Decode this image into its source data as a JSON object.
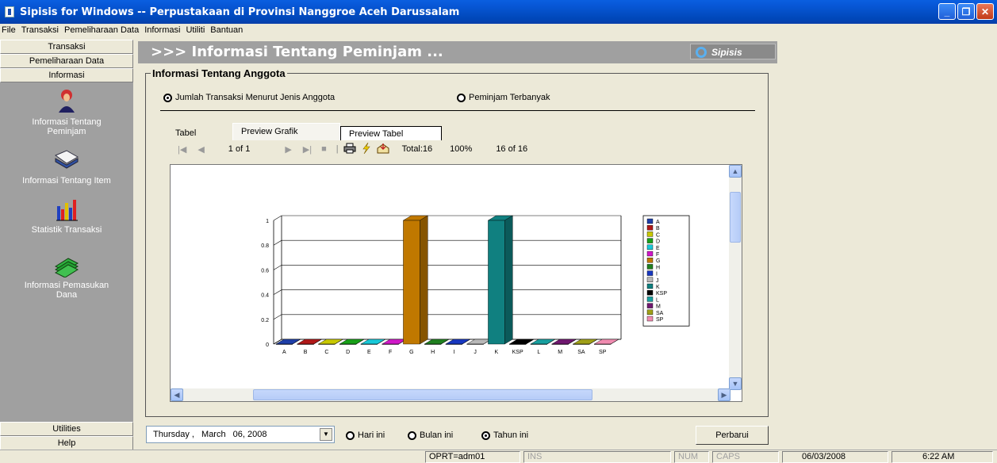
{
  "window": {
    "title": "Sipisis for Windows -- Perpustakaan di Provinsi Nanggroe Aceh Darussalam"
  },
  "menu": [
    "File",
    "Transaksi",
    "Pemeliharaan Data",
    "Informasi",
    "Utiliti",
    "Bantuan"
  ],
  "sidebar": {
    "headers": [
      "Transaksi",
      "Pemeliharaan Data",
      "Informasi"
    ],
    "items": [
      {
        "label": "Informasi Tentang Peminjam",
        "icon": "person-icon"
      },
      {
        "label": "Informasi Tentang Item",
        "icon": "book-icon"
      },
      {
        "label": "Statistik Transaksi",
        "icon": "bar-chart-icon"
      },
      {
        "label": "Informasi Pemasukan Dana",
        "icon": "money-icon"
      }
    ],
    "footer": [
      "Utilities",
      "Help"
    ]
  },
  "main": {
    "heading": ">>> Informasi Tentang Peminjam ...",
    "logo_text": "Sipisis",
    "group_title": "Informasi Tentang Anggota",
    "options": {
      "opt1": "Jumlah Transaksi Menurut Jenis Anggota",
      "opt2": "Peminjam Terbanyak"
    },
    "tabs": [
      "Tabel",
      "Preview Grafik",
      "Preview Tabel"
    ],
    "toolbar": {
      "page": "1 of 1",
      "total": "Total:16",
      "zoom": "100%",
      "records": "16 of 16"
    }
  },
  "chart_data": {
    "type": "bar",
    "categories": [
      "A",
      "B",
      "C",
      "D",
      "E",
      "F",
      "G",
      "H",
      "I",
      "J",
      "K",
      "KSP",
      "L",
      "M",
      "SA",
      "SP"
    ],
    "values": [
      0,
      0,
      0,
      0,
      0,
      0,
      1,
      0,
      0,
      0,
      1,
      0,
      0,
      0,
      0,
      0
    ],
    "colors": [
      "#1F3FA8",
      "#B01818",
      "#C8C800",
      "#18A018",
      "#18C8D8",
      "#D018C8",
      "#C07800",
      "#208020",
      "#1838C0",
      "#B8B8B8",
      "#108080",
      "#000000",
      "#18A0A0",
      "#701870",
      "#A0A018",
      "#F08CB0"
    ],
    "yticks": [
      "0",
      "0.2",
      "0.4",
      "0.6",
      "0.8",
      "1"
    ],
    "ylim": [
      0,
      1
    ],
    "legend": [
      "A",
      "B",
      "C",
      "D",
      "E",
      "F",
      "G",
      "H",
      "I",
      "J",
      "K",
      "KSP",
      "L",
      "M",
      "SA",
      "SP"
    ],
    "legend_position": "right"
  },
  "footer": {
    "date_day": "Thursday ,",
    "date_month": "March",
    "date_rest": "06, 2008",
    "range": {
      "r1": "Hari ini",
      "r2": "Bulan ini",
      "r3": "Tahun ini"
    },
    "refresh": "Perbarui"
  },
  "status": {
    "operator": "OPRT=adm01",
    "ins": "INS",
    "num": "NUM",
    "caps": "CAPS",
    "date": "06/03/2008",
    "time": "6:22 AM"
  }
}
